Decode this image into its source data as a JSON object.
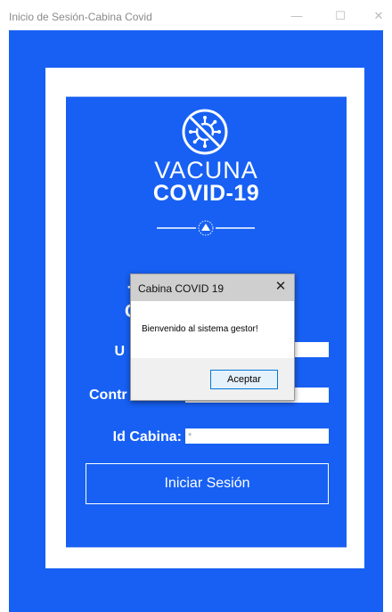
{
  "window": {
    "title": "Inicio de Sesión-Cabina Covid"
  },
  "logo": {
    "line1": "VACUNA",
    "line2": "COVID-19"
  },
  "heading": {
    "line1": "- I                          -",
    "line2": "C                          O"
  },
  "form": {
    "user_label": "U",
    "password_label": "Contr",
    "cabin_label": "Id Cabina:",
    "cabin_value": "*"
  },
  "login_button": "Iniciar Sesión",
  "dialog": {
    "title": "Cabina COVID 19",
    "message": "Bienvenido al sistema gestor!",
    "ok_label": "Aceptar"
  },
  "colors": {
    "brand_blue": "#1760f3",
    "white": "#ffffff"
  },
  "icons": {
    "minimize": "minimize-icon",
    "maximize": "maximize-icon",
    "close": "close-icon",
    "logo": "virus-crossed-icon",
    "emblem": "national-emblem-icon"
  }
}
